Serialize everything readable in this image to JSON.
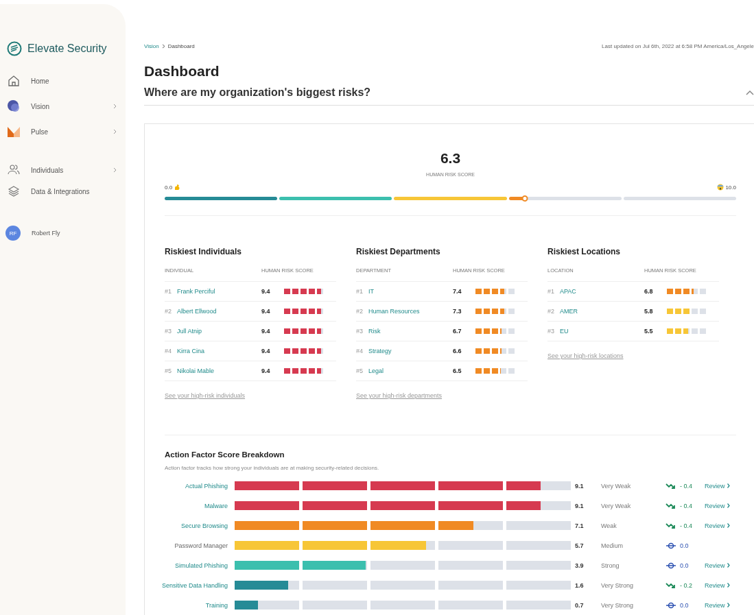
{
  "sidebar": {
    "brand": "Elevate Security",
    "items": [
      {
        "label": "Home",
        "expandable": false
      },
      {
        "label": "Vision",
        "expandable": true
      },
      {
        "label": "Pulse",
        "expandable": true
      },
      {
        "label": "Individuals",
        "expandable": true
      },
      {
        "label": "Data & Integrations",
        "expandable": false
      }
    ],
    "user": {
      "initials": "RF",
      "name": "Robert Fly"
    }
  },
  "breadcrumb": [
    "Vision",
    "Dashboard"
  ],
  "last_updated": "Last updated on Jul 6th, 2022 at 6:58 PM America/Los_Angele",
  "page_title": "Dashboard",
  "section": {
    "title": "Where are my organization's biggest risks?",
    "expanded": true
  },
  "risk_score": {
    "value": "6.3",
    "label": "HUMAN RISK SCORE",
    "min": "0.0",
    "max": "10.0",
    "level": 0.63
  },
  "tables": [
    {
      "title": "Riskiest Individuals",
      "columns": [
        "INDIVIDUAL",
        "HUMAN RISK SCORE"
      ],
      "link": "See your high-risk individuals",
      "rows": [
        {
          "rank": "#1",
          "name": "Frank Perciful",
          "score": "9.4",
          "level": 0.94,
          "color": "#d63a50"
        },
        {
          "rank": "#2",
          "name": "Albert Ellwood",
          "score": "9.4",
          "level": 0.94,
          "color": "#d63a50"
        },
        {
          "rank": "#3",
          "name": "Jull Atnip",
          "score": "9.4",
          "level": 0.94,
          "color": "#d63a50"
        },
        {
          "rank": "#4",
          "name": "Kirra Cina",
          "score": "9.4",
          "level": 0.94,
          "color": "#d63a50"
        },
        {
          "rank": "#5",
          "name": "Nikolai Mable",
          "score": "9.4",
          "level": 0.94,
          "color": "#d63a50"
        }
      ]
    },
    {
      "title": "Riskiest Departments",
      "columns": [
        "DEPARTMENT",
        "HUMAN RISK SCORE"
      ],
      "link": "See your high-risk departments",
      "rows": [
        {
          "rank": "#1",
          "name": "IT",
          "score": "7.4",
          "level": 0.74,
          "color": "#f08a24"
        },
        {
          "rank": "#2",
          "name": "Human Resources",
          "score": "7.3",
          "level": 0.73,
          "color": "#f08a24"
        },
        {
          "rank": "#3",
          "name": "Risk",
          "score": "6.7",
          "level": 0.67,
          "color": "#f08a24"
        },
        {
          "rank": "#4",
          "name": "Strategy",
          "score": "6.6",
          "level": 0.66,
          "color": "#f08a24"
        },
        {
          "rank": "#5",
          "name": "Legal",
          "score": "6.5",
          "level": 0.65,
          "color": "#f08a24"
        }
      ]
    },
    {
      "title": "Riskiest Locations",
      "columns": [
        "LOCATION",
        "HUMAN RISK SCORE"
      ],
      "link": "See your high-risk locations",
      "rows": [
        {
          "rank": "#1",
          "name": "APAC",
          "score": "6.8",
          "level": 0.68,
          "color": "#f08a24"
        },
        {
          "rank": "#2",
          "name": "AMER",
          "score": "5.8",
          "level": 0.58,
          "color": "#f7c637"
        },
        {
          "rank": "#3",
          "name": "EU",
          "score": "5.5",
          "level": 0.55,
          "color": "#f7c637"
        }
      ]
    }
  ],
  "breakdown": {
    "title": "Action Factor Score Breakdown",
    "subtitle": "Action factor tracks how strong your individuals are at making security-related decisions.",
    "rows": [
      {
        "label": "Actual Phishing",
        "link": true,
        "level": 0.91,
        "color": "#d63a50",
        "score": "9.1",
        "rating": "Very Weak",
        "kind": "down",
        "change": "- 0.4",
        "review": "Review"
      },
      {
        "label": "Malware",
        "link": true,
        "level": 0.91,
        "color": "#d63a50",
        "score": "9.1",
        "rating": "Very Weak",
        "kind": "down",
        "change": "- 0.4",
        "review": "Review"
      },
      {
        "label": "Secure Browsing",
        "link": true,
        "level": 0.71,
        "color": "#f08a24",
        "score": "7.1",
        "rating": "Weak",
        "kind": "down",
        "change": "- 0.4",
        "review": "Review"
      },
      {
        "label": "Password Manager",
        "link": false,
        "level": 0.57,
        "color": "#f7c637",
        "score": "5.7",
        "rating": "Medium",
        "kind": "flat",
        "change": "0.0"
      },
      {
        "label": "Simulated Phishing",
        "link": true,
        "level": 0.39,
        "color": "#3cbfae",
        "score": "3.9",
        "rating": "Strong",
        "kind": "flat",
        "change": "0.0",
        "review": "Review"
      },
      {
        "label": "Sensitive Data Handling",
        "link": true,
        "level": 0.16,
        "color": "#268b96",
        "score": "1.6",
        "rating": "Very Strong",
        "kind": "down",
        "change": "- 0.2",
        "review": "Review"
      },
      {
        "label": "Training",
        "link": true,
        "level": 0.07,
        "color": "#268b96",
        "score": "0.7",
        "rating": "Very Strong",
        "kind": "flat",
        "change": "0.0",
        "review": "Review"
      }
    ]
  }
}
